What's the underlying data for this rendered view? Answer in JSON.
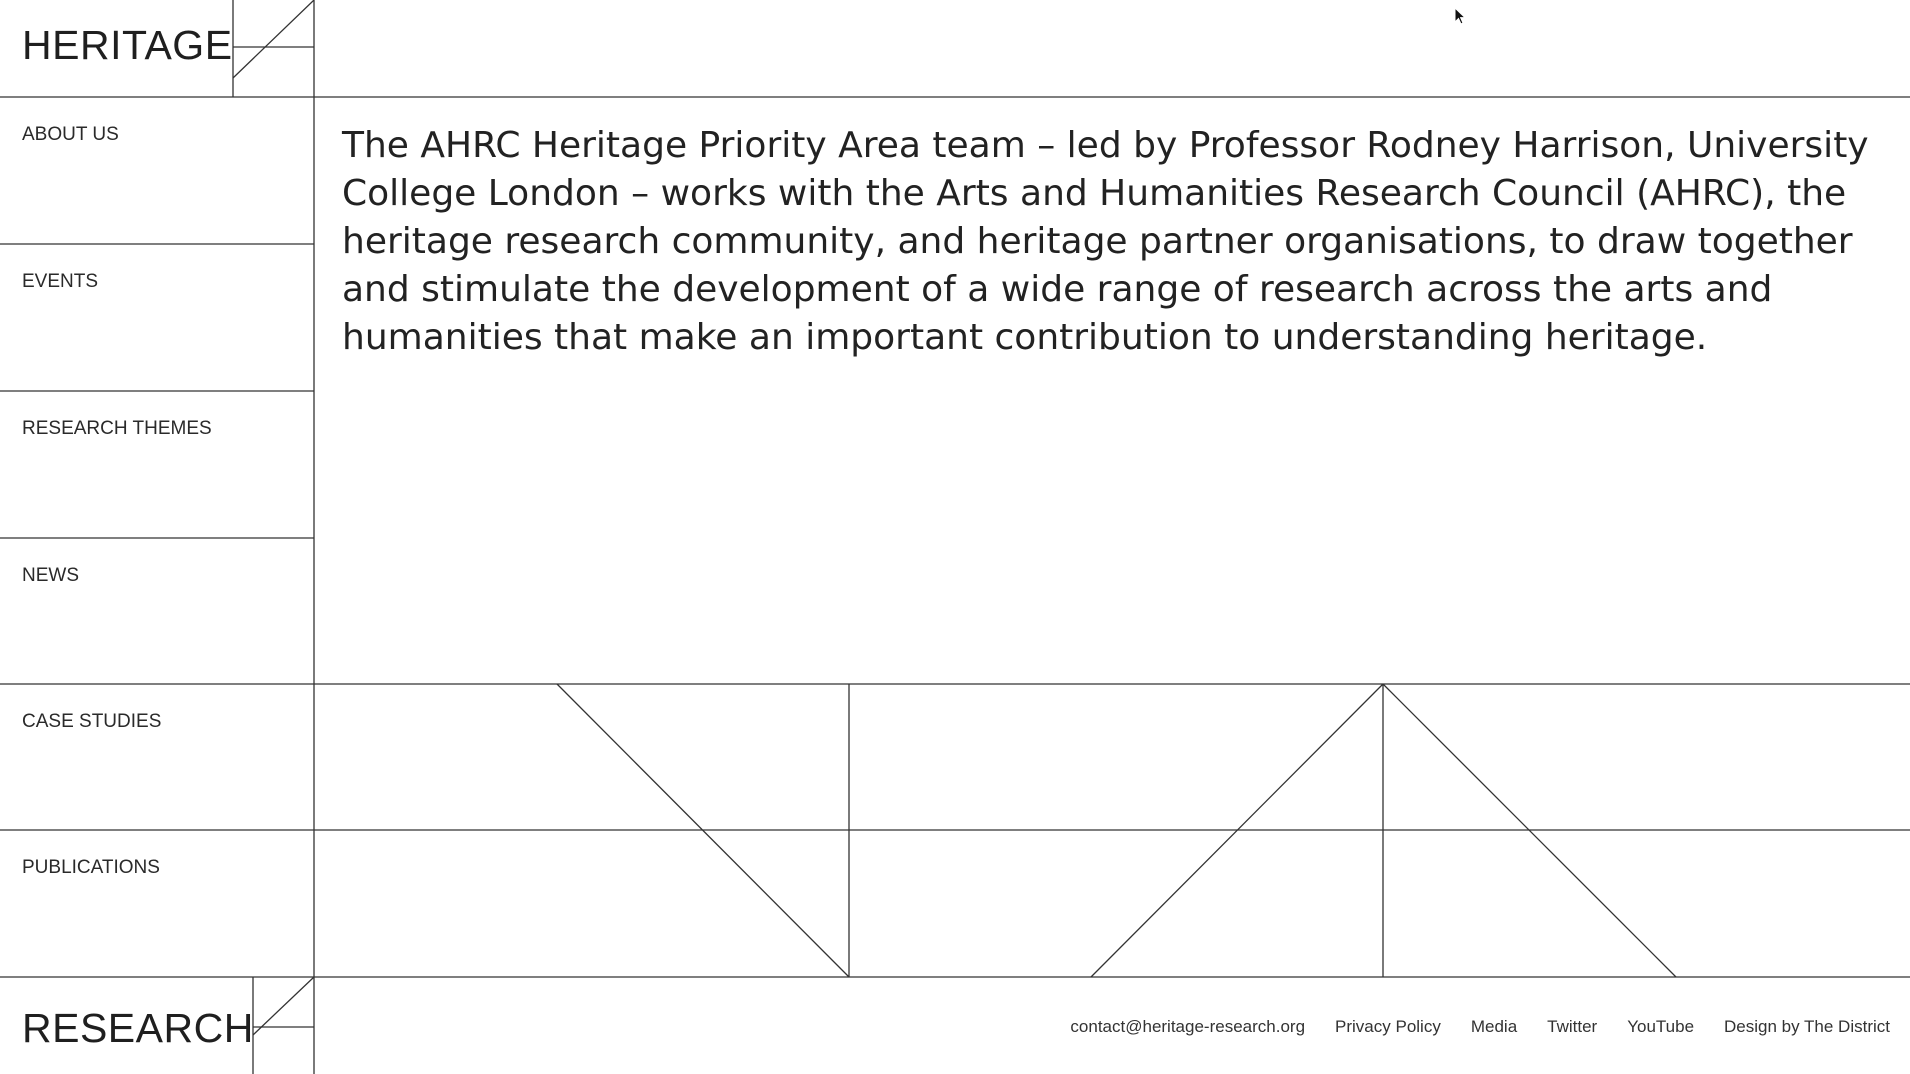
{
  "logo": {
    "top_word": "HERITAGE",
    "bottom_word": "RESEARCH"
  },
  "nav": {
    "items": [
      {
        "label": "ABOUT US"
      },
      {
        "label": "EVENTS"
      },
      {
        "label": "RESEARCH THEMES"
      },
      {
        "label": "NEWS"
      },
      {
        "label": "CASE STUDIES"
      },
      {
        "label": "PUBLICATIONS"
      }
    ]
  },
  "main": {
    "intro": "The AHRC Heritage Priority Area team – led by Professor Rodney Harrison, University College London – works with the Arts and Humanities Research Council (AHRC), the heritage research community, and heritage partner organisations, to draw together and stimulate the development of a wide range of research across the arts and humanities that make an important contribution to understanding heritage."
  },
  "footer": {
    "links": [
      {
        "label": "contact@heritage-research.org"
      },
      {
        "label": "Privacy Policy"
      },
      {
        "label": "Media"
      },
      {
        "label": "Twitter"
      },
      {
        "label": "YouTube"
      },
      {
        "label": "Design by The District"
      }
    ]
  },
  "colors": {
    "line": "#333333",
    "text": "#222222",
    "background": "#ffffff"
  }
}
